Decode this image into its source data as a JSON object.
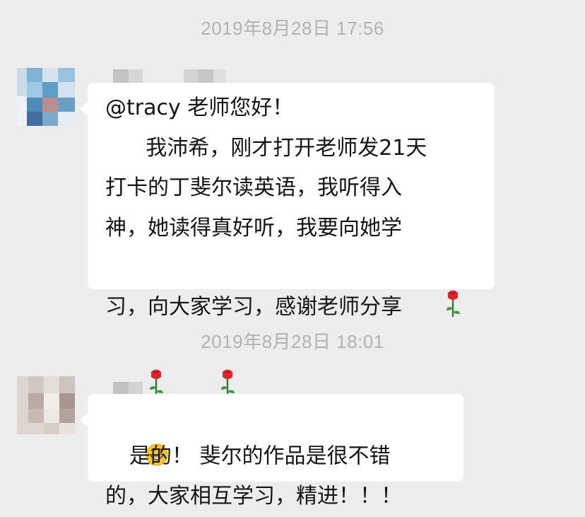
{
  "conversation": [
    {
      "timestamp": "2019年8月28日 17:56",
      "message": {
        "lines": [
          "@tracy 老师您好！",
          "      我沛希，刚才打开老师发21天",
          "打卡的丁斐尔读英语，我听得入",
          "神，她读得真好听，我要向她学",
          "习，向大家学习，感谢老师分享"
        ],
        "trailing_emojis": [
          "rose",
          "rose",
          "rose"
        ]
      }
    },
    {
      "timestamp": "2019年8月28日 18:01",
      "message": {
        "leading_emoji": "grin",
        "lines": [
          "是的！ 斐尔的作品是很不错",
          "的，大家相互学习，精进！！！"
        ]
      }
    }
  ],
  "colors": {
    "background": "#ededed",
    "bubble": "#ffffff",
    "timestamp": "#b3b3b3",
    "text": "#151515"
  }
}
